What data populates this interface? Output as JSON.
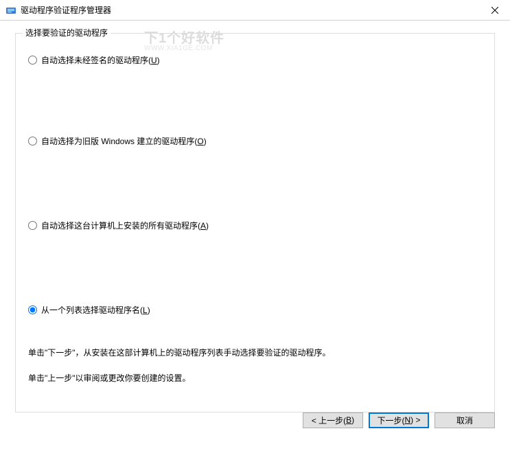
{
  "window": {
    "title": "驱动程序验证程序管理器"
  },
  "group": {
    "label": "选择要验证的驱动程序"
  },
  "options": {
    "opt1_pre": "自动选择未经签名的驱动程序(",
    "opt1_key": "U",
    "opt1_post": ")",
    "opt2_pre": "自动选择为旧版 Windows 建立的驱动程序(",
    "opt2_key": "O",
    "opt2_post": ")",
    "opt3_pre": "自动选择这台计算机上安装的所有驱动程序(",
    "opt3_key": "A",
    "opt3_post": ")",
    "opt4_pre": "从一个列表选择驱动程序名(",
    "opt4_key": "L",
    "opt4_post": ")"
  },
  "desc": {
    "line1": "单击\"下一步\"，从安装在这部计算机上的驱动程序列表手动选择要验证的驱动程序。",
    "line2": "单击\"上一步\"以审阅或更改你要创建的设置。"
  },
  "buttons": {
    "back_pre": "< 上一步(",
    "back_key": "B",
    "back_post": ")",
    "next_pre": "下一步(",
    "next_key": "N",
    "next_post": ") >",
    "cancel": "取消"
  },
  "watermark": {
    "line1": "下1个好软件",
    "line2": "WWW.XIA1GE.COM"
  }
}
